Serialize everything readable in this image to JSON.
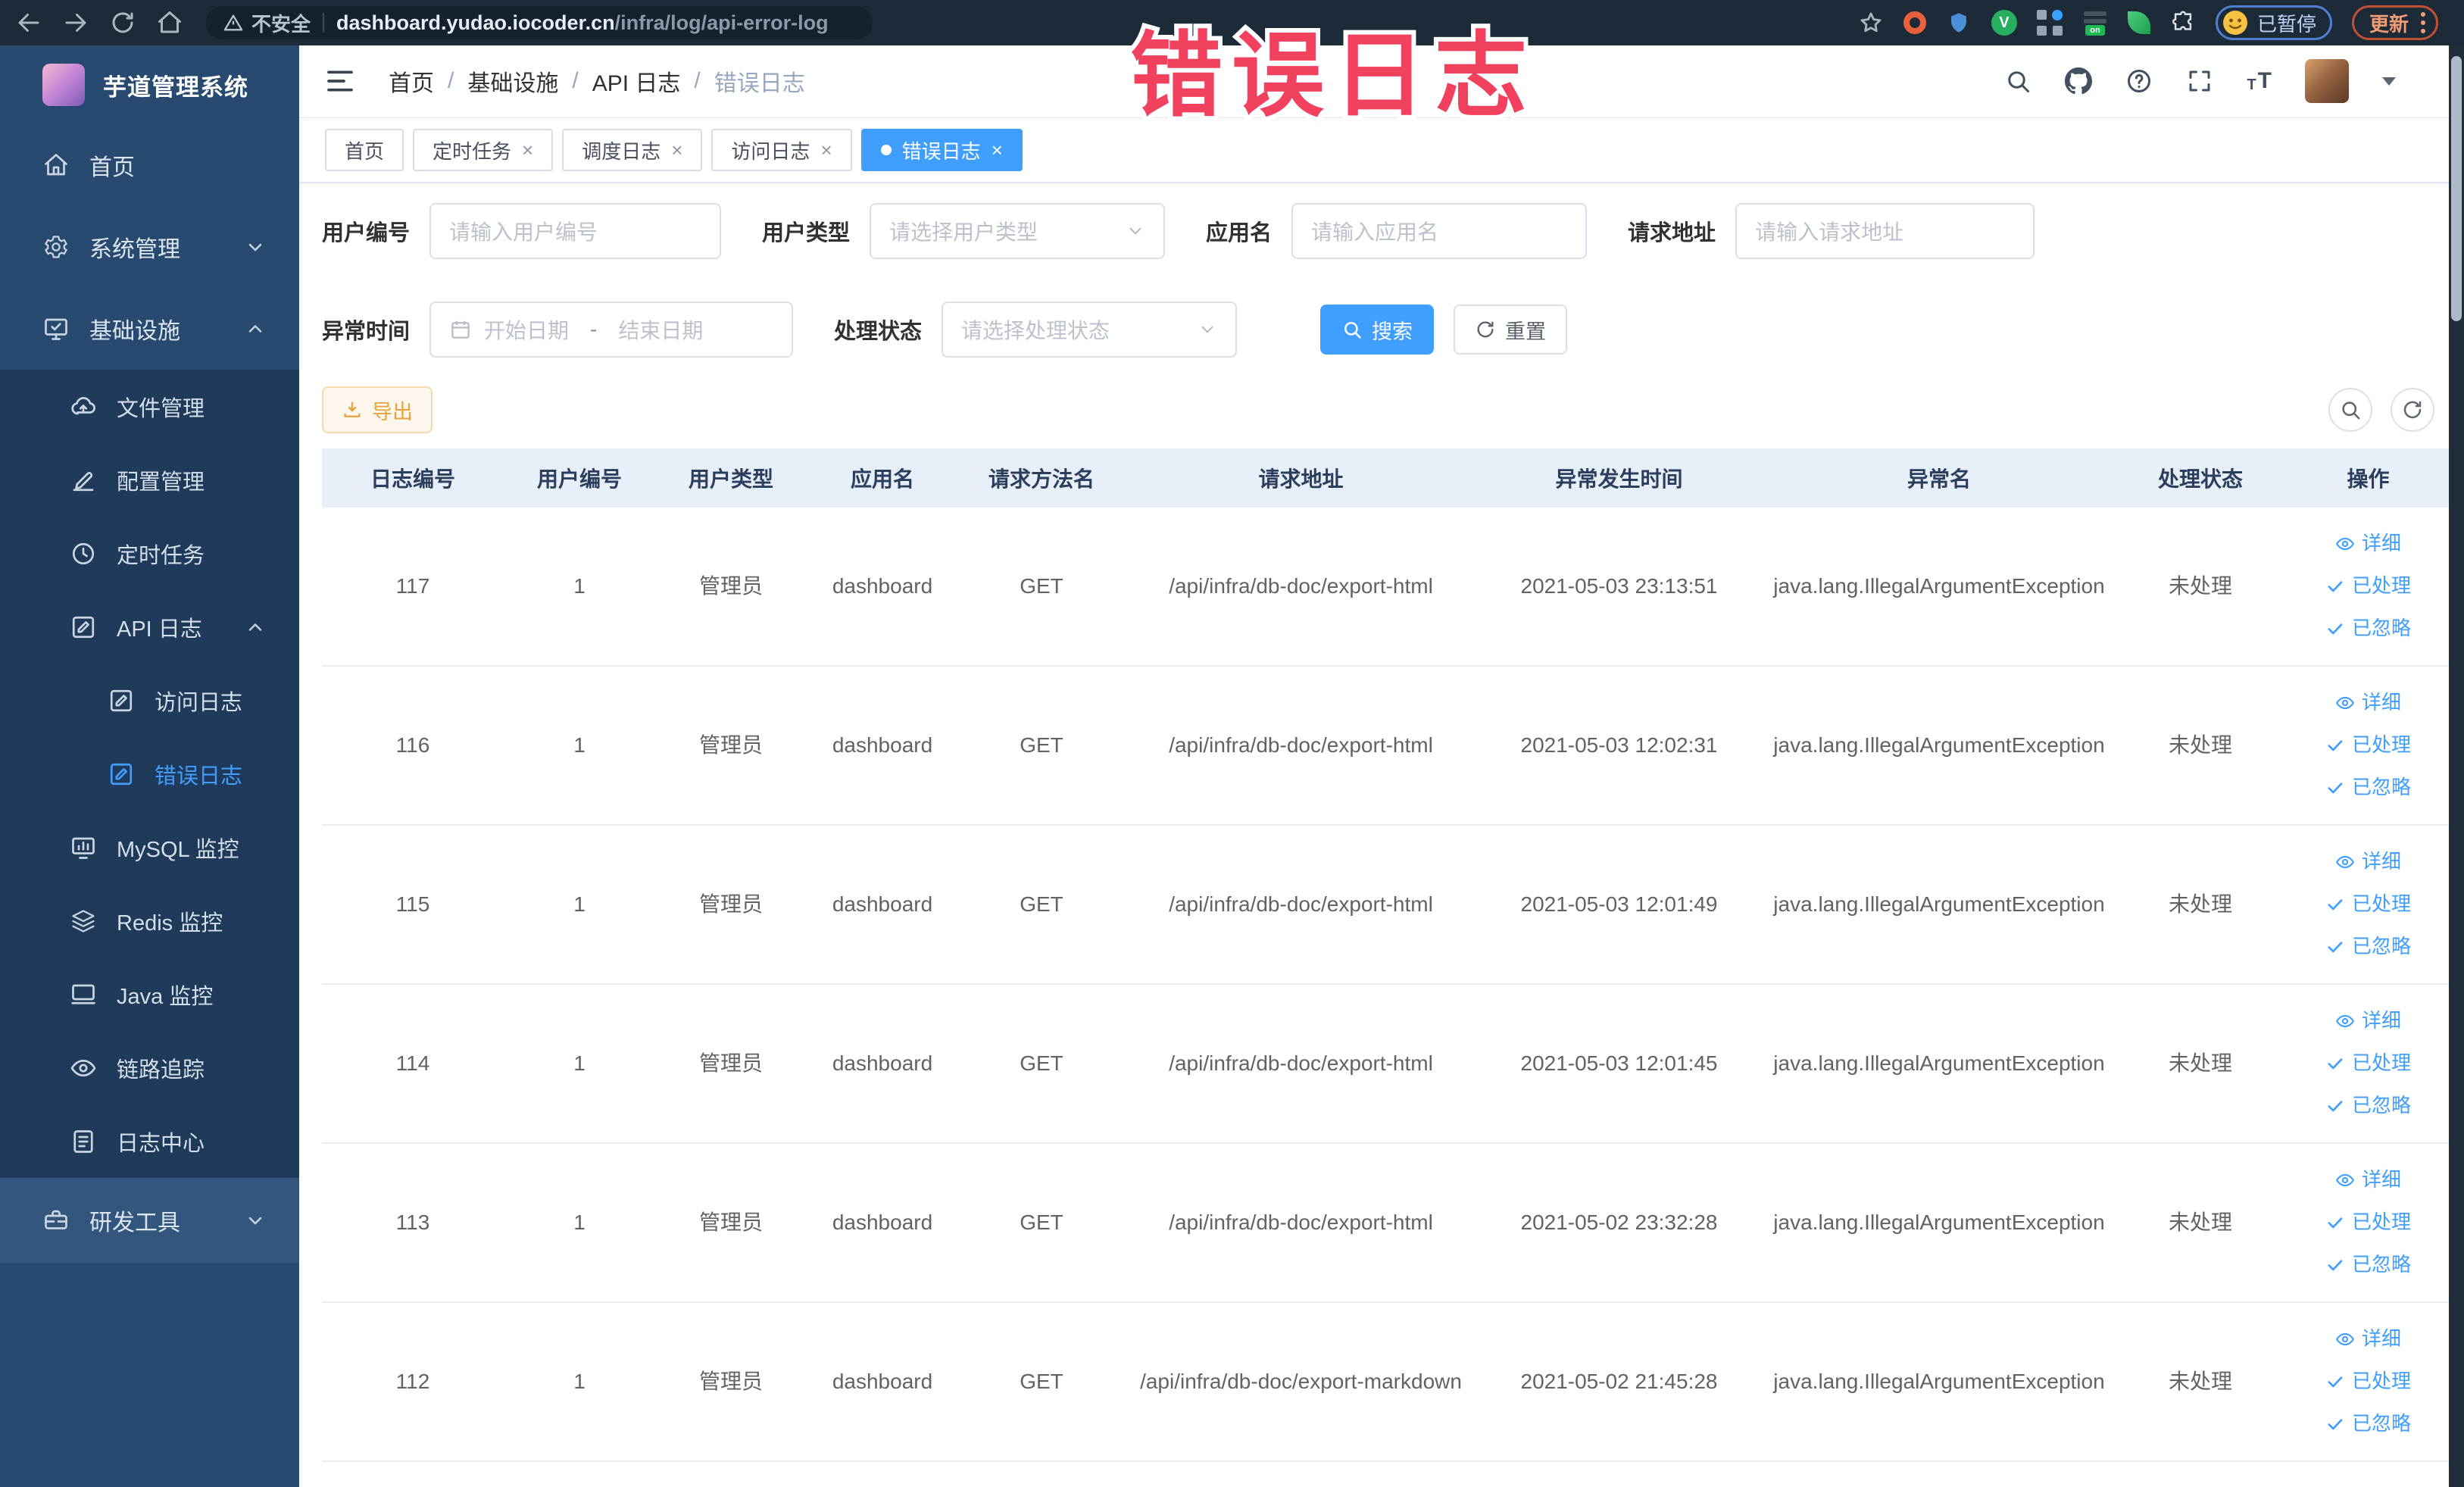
{
  "browser": {
    "security_label": "不安全",
    "url_host": "dashboard.yudao.iocoder.cn",
    "url_path": "/infra/log/api-error-log",
    "paused_badge": "已暂停",
    "update_button": "更新"
  },
  "annotation": {
    "text": "错误日志",
    "color": "#f2415e"
  },
  "sidebar": {
    "title": "芋道管理系统",
    "items": [
      {
        "key": "home",
        "label": "首页",
        "icon": "home",
        "level": 1,
        "zone": "top"
      },
      {
        "key": "system",
        "label": "系统管理",
        "icon": "gear",
        "level": 1,
        "zone": "top",
        "chevron": "down"
      },
      {
        "key": "infra",
        "label": "基础设施",
        "icon": "infra",
        "level": 1,
        "zone": "top",
        "chevron": "up"
      },
      {
        "key": "file",
        "label": "文件管理",
        "icon": "file",
        "level": 2,
        "zone": "sub"
      },
      {
        "key": "config",
        "label": "配置管理",
        "icon": "config",
        "level": 2,
        "zone": "sub"
      },
      {
        "key": "job",
        "label": "定时任务",
        "icon": "job",
        "level": 2,
        "zone": "sub"
      },
      {
        "key": "api-log",
        "label": "API 日志",
        "icon": "apilog",
        "level": 2,
        "zone": "sub",
        "chevron": "up"
      },
      {
        "key": "access-log",
        "label": "访问日志",
        "icon": "accesslog",
        "level": 3,
        "zone": "sub"
      },
      {
        "key": "error-log",
        "label": "错误日志",
        "icon": "errorlog",
        "level": 3,
        "zone": "sub",
        "active": true
      },
      {
        "key": "mysql",
        "label": "MySQL 监控",
        "icon": "mysql",
        "level": 2,
        "zone": "sub"
      },
      {
        "key": "redis",
        "label": "Redis 监控",
        "icon": "redis",
        "level": 2,
        "zone": "sub"
      },
      {
        "key": "java",
        "label": "Java 监控",
        "icon": "java",
        "level": 2,
        "zone": "sub"
      },
      {
        "key": "trace",
        "label": "链路追踪",
        "icon": "trace",
        "level": 2,
        "zone": "sub"
      },
      {
        "key": "log-center",
        "label": "日志中心",
        "icon": "logcenter",
        "level": 2,
        "zone": "sub"
      },
      {
        "key": "devtools",
        "label": "研发工具",
        "icon": "devtools",
        "level": 1,
        "zone": "base",
        "chevron": "down"
      }
    ]
  },
  "breadcrumb": {
    "items": [
      "首页",
      "基础设施",
      "API 日志",
      "错误日志"
    ]
  },
  "tabs": [
    {
      "label": "首页",
      "closable": false,
      "active": false
    },
    {
      "label": "定时任务",
      "closable": true,
      "active": false
    },
    {
      "label": "调度日志",
      "closable": true,
      "active": false
    },
    {
      "label": "访问日志",
      "closable": true,
      "active": false
    },
    {
      "label": "错误日志",
      "closable": true,
      "active": true
    }
  ],
  "filters": {
    "user_id": {
      "label": "用户编号",
      "placeholder": "请输入用户编号"
    },
    "user_type": {
      "label": "用户类型",
      "placeholder": "请选择用户类型"
    },
    "app_name": {
      "label": "应用名",
      "placeholder": "请输入应用名"
    },
    "request_url": {
      "label": "请求地址",
      "placeholder": "请输入请求地址"
    },
    "exception_time": {
      "label": "异常时间",
      "start_placeholder": "开始日期",
      "separator": "-",
      "end_placeholder": "结束日期"
    },
    "process_status": {
      "label": "处理状态",
      "placeholder": "请选择处理状态"
    },
    "search_button": "搜索",
    "reset_button": "重置"
  },
  "toolbar": {
    "export_button": "导出"
  },
  "table": {
    "columns": [
      "日志编号",
      "用户编号",
      "用户类型",
      "应用名",
      "请求方法名",
      "请求地址",
      "异常发生时间",
      "异常名",
      "处理状态",
      "操作"
    ],
    "actions": {
      "detail": "详细",
      "processed": "已处理",
      "ignored": "已忽略"
    },
    "rows": [
      {
        "log_id": "117",
        "user_id": "1",
        "user_type": "管理员",
        "app_name": "dashboard",
        "method": "GET",
        "url": "/api/infra/db-doc/export-html",
        "time": "2021-05-03 23:13:51",
        "exception": "java.lang.IllegalArgumentException",
        "status": "未处理"
      },
      {
        "log_id": "116",
        "user_id": "1",
        "user_type": "管理员",
        "app_name": "dashboard",
        "method": "GET",
        "url": "/api/infra/db-doc/export-html",
        "time": "2021-05-03 12:02:31",
        "exception": "java.lang.IllegalArgumentException",
        "status": "未处理"
      },
      {
        "log_id": "115",
        "user_id": "1",
        "user_type": "管理员",
        "app_name": "dashboard",
        "method": "GET",
        "url": "/api/infra/db-doc/export-html",
        "time": "2021-05-03 12:01:49",
        "exception": "java.lang.IllegalArgumentException",
        "status": "未处理"
      },
      {
        "log_id": "114",
        "user_id": "1",
        "user_type": "管理员",
        "app_name": "dashboard",
        "method": "GET",
        "url": "/api/infra/db-doc/export-html",
        "time": "2021-05-03 12:01:45",
        "exception": "java.lang.IllegalArgumentException",
        "status": "未处理"
      },
      {
        "log_id": "113",
        "user_id": "1",
        "user_type": "管理员",
        "app_name": "dashboard",
        "method": "GET",
        "url": "/api/infra/db-doc/export-html",
        "time": "2021-05-02 23:32:28",
        "exception": "java.lang.IllegalArgumentException",
        "status": "未处理"
      },
      {
        "log_id": "112",
        "user_id": "1",
        "user_type": "管理员",
        "app_name": "dashboard",
        "method": "GET",
        "url": "/api/infra/db-doc/export-markdown",
        "time": "2021-05-02 21:45:28",
        "exception": "java.lang.IllegalArgumentException",
        "status": "未处理"
      }
    ]
  },
  "colors": {
    "primary": "#409eff",
    "warning": "#e6a23c",
    "annotation": "#f2415e",
    "sidebar_bg": "#294a70",
    "submenu_bg": "#1f3a5a",
    "chrome_bg": "#1d2a37",
    "table_header_bg": "#e9eff8"
  }
}
